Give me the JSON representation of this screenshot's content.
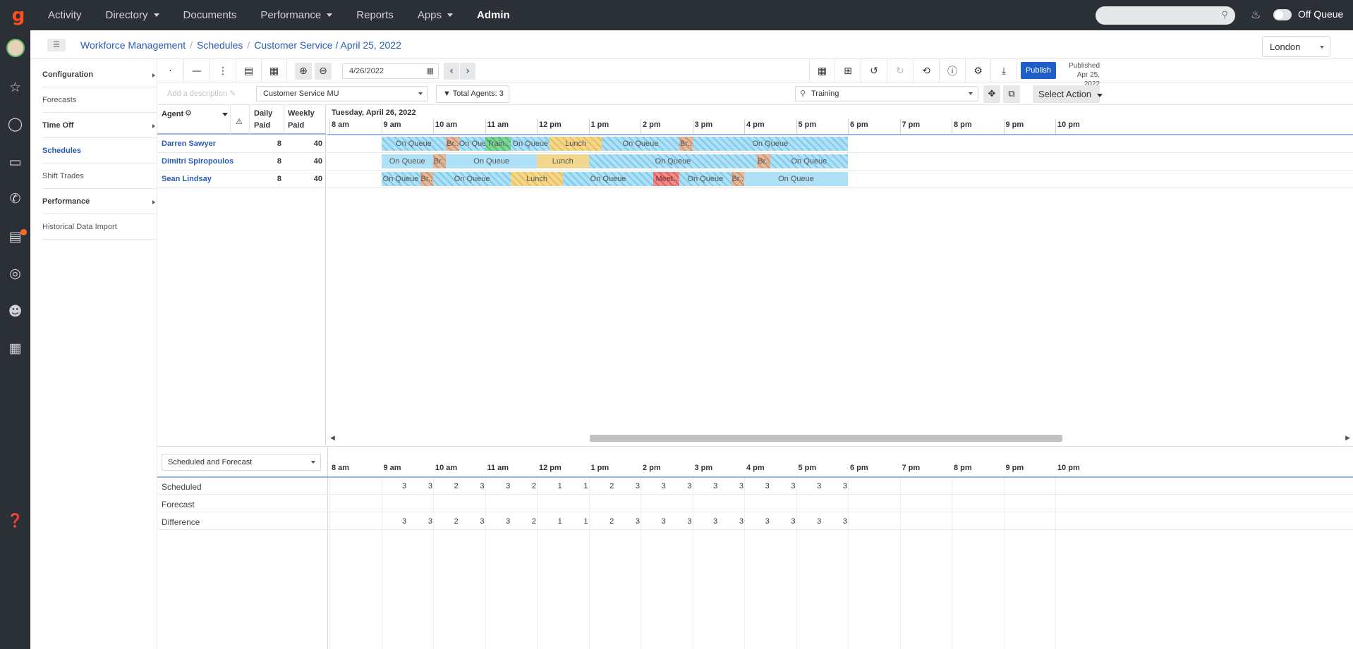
{
  "topnav": {
    "items": [
      {
        "label": "Activity",
        "caret": false
      },
      {
        "label": "Directory",
        "caret": true
      },
      {
        "label": "Documents",
        "caret": false
      },
      {
        "label": "Performance",
        "caret": true
      },
      {
        "label": "Reports",
        "caret": false
      },
      {
        "label": "Apps",
        "caret": true
      },
      {
        "label": "Admin",
        "caret": false,
        "active": true
      }
    ],
    "queue_status": "Off Queue"
  },
  "breadcrumb": {
    "items": [
      "Workforce Management",
      "Schedules",
      "Customer Service / April 25, 2022"
    ]
  },
  "timezone": "London",
  "sidemenu": [
    {
      "label": "Configuration",
      "style": "bold",
      "arrow": true
    },
    {
      "label": "Forecasts",
      "style": "normal",
      "arrow": false
    },
    {
      "label": "Time Off",
      "style": "bold",
      "arrow": true
    },
    {
      "label": "Schedules",
      "style": "selected",
      "arrow": false
    },
    {
      "label": "Shift Trades",
      "style": "normal",
      "arrow": false
    },
    {
      "label": "Performance",
      "style": "bold",
      "arrow": true
    },
    {
      "label": "Historical Data Import",
      "style": "normal",
      "arrow": false
    }
  ],
  "toolbar": {
    "date_value": "4/26/2022",
    "publish_label": "Publish",
    "published_label": "Published",
    "published_date": "Apr 25, 2022"
  },
  "filters": {
    "description_placeholder": "Add a description",
    "management_unit": "Customer Service MU",
    "total_agents": "Total Agents: 3",
    "activity_filter": "Training",
    "select_action": "Select Action"
  },
  "agents_table": {
    "col_agent": "Agent",
    "col_daily_1": "Daily",
    "col_daily_2": "Paid",
    "col_weekly_1": "Weekly",
    "col_weekly_2": "Paid"
  },
  "timeline": {
    "date_header": "Tuesday, April 26, 2022",
    "hours": [
      "8 am",
      "9 am",
      "10 am",
      "11 am",
      "12 pm",
      "1 pm",
      "2 pm",
      "3 pm",
      "4 pm",
      "5 pm",
      "6 pm",
      "7 pm",
      "8 pm",
      "9 pm",
      "10 pm"
    ]
  },
  "agents": [
    {
      "name": "Darren Sawyer",
      "daily": "8",
      "weekly": "40",
      "activities": [
        {
          "label": "On Queue",
          "type": "queue",
          "hatch": true,
          "start": 9.0,
          "end": 10.25
        },
        {
          "label": "Br..",
          "type": "break",
          "hatch": true,
          "start": 10.25,
          "end": 10.5
        },
        {
          "label": "On Queue",
          "type": "queue",
          "hatch": true,
          "start": 10.5,
          "end": 11.0
        },
        {
          "label": "Train..",
          "type": "training",
          "hatch": true,
          "start": 11.0,
          "end": 11.5
        },
        {
          "label": "On Queue",
          "type": "queue",
          "hatch": true,
          "start": 11.5,
          "end": 12.25
        },
        {
          "label": "Lunch",
          "type": "lunch",
          "hatch": true,
          "start": 12.25,
          "end": 13.25
        },
        {
          "label": "On Queue",
          "type": "queue",
          "hatch": true,
          "start": 13.25,
          "end": 14.75
        },
        {
          "label": "Br..",
          "type": "break",
          "hatch": true,
          "start": 14.75,
          "end": 15.0
        },
        {
          "label": "On Queue",
          "type": "queue",
          "hatch": true,
          "start": 15.0,
          "end": 18.0
        }
      ]
    },
    {
      "name": "Dimitri Spiropoulos",
      "daily": "8",
      "weekly": "40",
      "activities": [
        {
          "label": "On Queue",
          "type": "queue",
          "hatch": false,
          "start": 9.0,
          "end": 10.0
        },
        {
          "label": "Br..",
          "type": "break",
          "hatch": true,
          "start": 10.0,
          "end": 10.25
        },
        {
          "label": "On Queue",
          "type": "queue",
          "hatch": false,
          "start": 10.25,
          "end": 12.0
        },
        {
          "label": "Lunch",
          "type": "lunch",
          "hatch": false,
          "start": 12.0,
          "end": 13.0
        },
        {
          "label": "On Queue",
          "type": "queue",
          "hatch": true,
          "start": 13.0,
          "end": 16.25
        },
        {
          "label": "Br..",
          "type": "break",
          "hatch": true,
          "start": 16.25,
          "end": 16.5
        },
        {
          "label": "On Queue",
          "type": "queue",
          "hatch": true,
          "start": 16.5,
          "end": 18.0
        }
      ]
    },
    {
      "name": "Sean Lindsay",
      "daily": "8",
      "weekly": "40",
      "activities": [
        {
          "label": "On Queue",
          "type": "queue",
          "hatch": true,
          "start": 9.0,
          "end": 9.75
        },
        {
          "label": "Br..",
          "type": "break",
          "hatch": true,
          "start": 9.75,
          "end": 10.0
        },
        {
          "label": "On Queue",
          "type": "queue",
          "hatch": true,
          "start": 10.0,
          "end": 11.5
        },
        {
          "label": "Lunch",
          "type": "lunch",
          "hatch": true,
          "start": 11.5,
          "end": 12.5
        },
        {
          "label": "On Queue",
          "type": "queue",
          "hatch": true,
          "start": 12.5,
          "end": 14.25
        },
        {
          "label": "Meet..",
          "type": "meeting",
          "hatch": true,
          "start": 14.25,
          "end": 14.75
        },
        {
          "label": "On Queue",
          "type": "queue",
          "hatch": true,
          "start": 14.75,
          "end": 15.75
        },
        {
          "label": "Br..",
          "type": "break",
          "hatch": true,
          "start": 15.75,
          "end": 16.0
        },
        {
          "label": "On Queue",
          "type": "queue",
          "hatch": false,
          "start": 16.0,
          "end": 18.0
        }
      ]
    }
  ],
  "bottom": {
    "view_select": "Scheduled and Forecast",
    "rows": [
      {
        "label": "Scheduled",
        "values": [
          "3",
          "3",
          "2",
          "3",
          "3",
          "2",
          "1",
          "1",
          "2",
          "3",
          "3",
          "3",
          "3",
          "3",
          "3",
          "3",
          "3",
          "3"
        ]
      },
      {
        "label": "Forecast",
        "values": []
      },
      {
        "label": "Difference",
        "values": [
          "3",
          "3",
          "2",
          "3",
          "3",
          "2",
          "1",
          "1",
          "2",
          "3",
          "3",
          "3",
          "3",
          "3",
          "3",
          "3",
          "3",
          "3"
        ]
      }
    ]
  }
}
